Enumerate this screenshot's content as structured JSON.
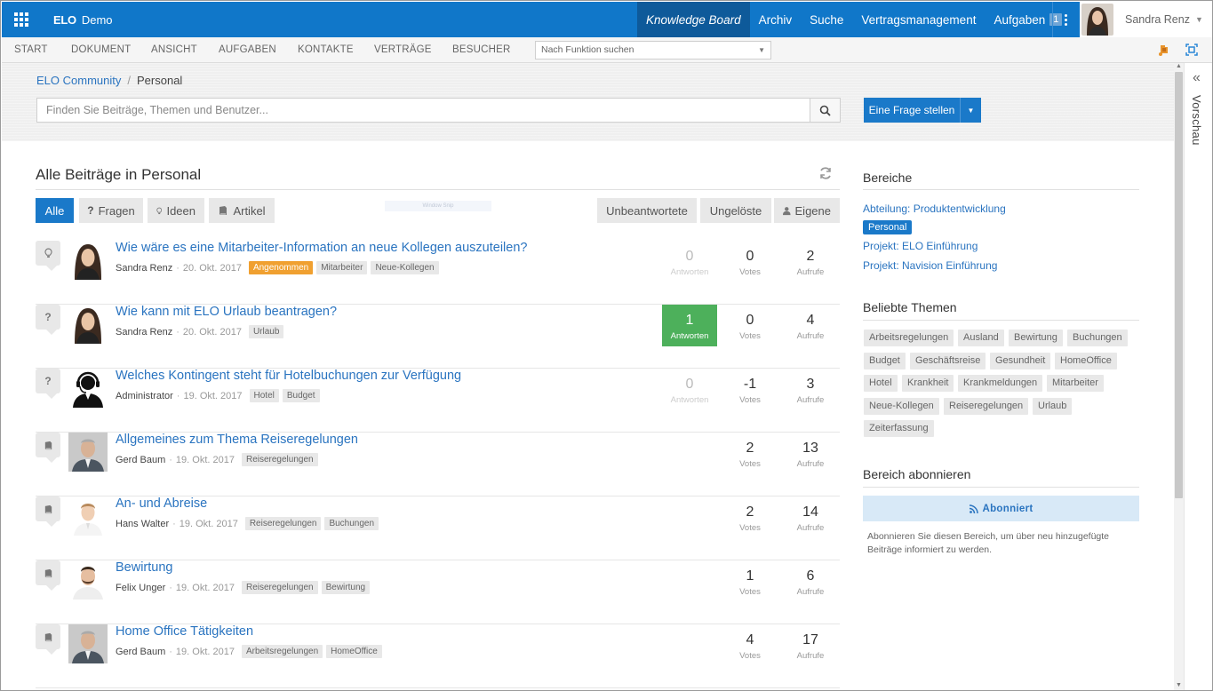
{
  "topbar": {
    "brand_logo": "ELO",
    "brand_name": "Demo",
    "nav": [
      {
        "label": "Knowledge Board",
        "active": true
      },
      {
        "label": "Archiv",
        "active": false
      },
      {
        "label": "Suche",
        "active": false
      },
      {
        "label": "Vertragsmanagement",
        "active": false
      },
      {
        "label": "Aufgaben",
        "active": false,
        "badge": "1"
      }
    ],
    "user_name": "Sandra Renz"
  },
  "ribbon": {
    "items": [
      "START",
      "DOKUMENT",
      "ANSICHT",
      "AUFGABEN",
      "KONTAKTE",
      "VERTRÄGE",
      "BESUCHER"
    ],
    "function_search": "Nach Funktion suchen"
  },
  "breadcrumb": {
    "root": "ELO Community",
    "separator": "/",
    "current": "Personal"
  },
  "search": {
    "placeholder": "Finden Sie Beiträge, Themen und Benutzer..."
  },
  "ask_button": "Eine Frage stellen",
  "preview_label": "Vorschau",
  "preview_toggle": "«",
  "main": {
    "title": "Alle Beiträge in Personal",
    "filters_left": [
      "Alle",
      "Fragen",
      "Ideen",
      "Artikel"
    ],
    "filters_right": [
      "Unbeantwortete",
      "Ungelöste",
      "Eigene"
    ],
    "watermark": "Window Snip",
    "posts": [
      {
        "type": "idea",
        "avatar": "woman",
        "title": "Wie wäre es eine Mitarbeiter-Information an neue Kollegen auszuteilen?",
        "author": "Sandra Renz",
        "date": "20. Okt. 2017",
        "tags": [
          "Angenommen",
          "Mitarbeiter",
          "Neue-Kollegen"
        ],
        "highlight_tag": "Angenommen",
        "answers": "0",
        "answers_label": "Antworten",
        "answers_state": "faded",
        "votes": "0",
        "votes_label": "Votes",
        "views": "2",
        "views_label": "Aufrufe"
      },
      {
        "type": "question",
        "avatar": "woman",
        "title": "Wie kann mit ELO Urlaub beantragen?",
        "author": "Sandra Renz",
        "date": "20. Okt. 2017",
        "tags": [
          "Urlaub"
        ],
        "answers": "1",
        "answers_label": "Antworten",
        "answers_state": "accepted",
        "votes": "0",
        "votes_label": "Votes",
        "views": "4",
        "views_label": "Aufrufe"
      },
      {
        "type": "question",
        "avatar": "admin",
        "title": "Welches Kontingent steht für Hotelbuchungen zur Verfügung",
        "author": "Administrator",
        "date": "19. Okt. 2017",
        "tags": [
          "Hotel",
          "Budget"
        ],
        "answers": "0",
        "answers_label": "Antworten",
        "answers_state": "faded",
        "votes": "-1",
        "votes_label": "Votes",
        "views": "3",
        "views_label": "Aufrufe"
      },
      {
        "type": "article",
        "avatar": "older-man",
        "title": "Allgemeines zum Thema Reiseregelungen",
        "author": "Gerd Baum",
        "date": "19. Okt. 2017",
        "tags": [
          "Reiseregelungen"
        ],
        "votes": "2",
        "votes_label": "Votes",
        "views": "13",
        "views_label": "Aufrufe"
      },
      {
        "type": "article",
        "avatar": "young-man",
        "title": "An- und Abreise",
        "author": "Hans Walter",
        "date": "19. Okt. 2017",
        "tags": [
          "Reiseregelungen",
          "Buchungen"
        ],
        "votes": "2",
        "votes_label": "Votes",
        "views": "14",
        "views_label": "Aufrufe"
      },
      {
        "type": "article",
        "avatar": "bearded-man",
        "title": "Bewirtung",
        "author": "Felix Unger",
        "date": "19. Okt. 2017",
        "tags": [
          "Reiseregelungen",
          "Bewirtung"
        ],
        "votes": "1",
        "votes_label": "Votes",
        "views": "6",
        "views_label": "Aufrufe"
      },
      {
        "type": "article",
        "avatar": "older-man",
        "title": "Home Office Tätigkeiten",
        "author": "Gerd Baum",
        "date": "19. Okt. 2017",
        "tags": [
          "Arbeitsregelungen",
          "HomeOffice"
        ],
        "votes": "4",
        "votes_label": "Votes",
        "views": "17",
        "views_label": "Aufrufe"
      }
    ]
  },
  "sidebar": {
    "areas_title": "Bereiche",
    "areas": [
      {
        "label": "Abteilung: Produktentwicklung",
        "active": false
      },
      {
        "label": "Personal",
        "active": true
      },
      {
        "label": "Projekt: ELO Einführung",
        "active": false
      },
      {
        "label": "Projekt: Navision Einführung",
        "active": false
      }
    ],
    "topics_title": "Beliebte Themen",
    "topics": [
      "Arbeitsregelungen",
      "Ausland",
      "Bewirtung",
      "Buchungen",
      "Budget",
      "Geschäftsreise",
      "Gesundheit",
      "HomeOffice",
      "Hotel",
      "Krankheit",
      "Krankmeldungen",
      "Mitarbeiter",
      "Neue-Kollegen",
      "Reiseregelungen",
      "Urlaub",
      "Zeiterfassung"
    ],
    "subscribe_title": "Bereich abonnieren",
    "subscribe_button": "Abonniert",
    "subscribe_note": "Abonnieren Sie diesen Bereich, um über neu hinzugefügte Beiträge informiert zu werden."
  },
  "colors": {
    "brand": "#1077c9",
    "accent": "#1a79c9",
    "accepted": "#4db05b",
    "highlight_tag": "#f0a030"
  }
}
